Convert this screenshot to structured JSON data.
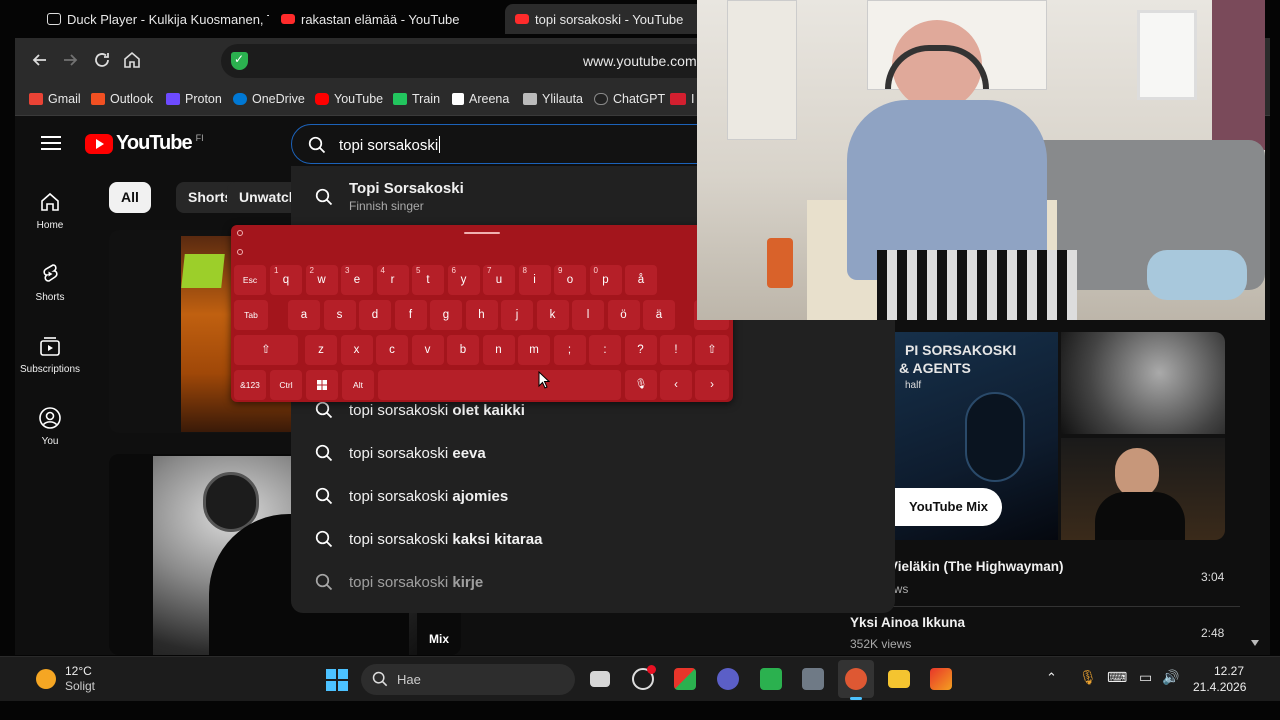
{
  "browser": {
    "tabs": [
      {
        "title": "Duck Player - Kulkija Kuosmanen, T"
      },
      {
        "title": "rakastan elämää - YouTube"
      },
      {
        "title": "topi sorsakoski - YouTube"
      }
    ],
    "url": "www.youtube.com",
    "bookmarks": [
      {
        "label": "Gmail",
        "color": "#ea4335"
      },
      {
        "label": "Outlook",
        "color": "#f25022"
      },
      {
        "label": "Proton",
        "color": "#6d4aff"
      },
      {
        "label": "OneDrive",
        "color": "#0078d4"
      },
      {
        "label": "YouTube",
        "color": "#ff0000"
      },
      {
        "label": "Train",
        "color": "#22c55e"
      },
      {
        "label": "Areena",
        "color": "#ffffff"
      },
      {
        "label": "Ylilauta",
        "color": "#bbbbbb"
      },
      {
        "label": "ChatGPT",
        "color": "#222222"
      },
      {
        "label": "I",
        "color": "#d31f2f"
      }
    ]
  },
  "youtube": {
    "logo_text": "YouTube",
    "country_code": "FI",
    "search": {
      "query": "topi sorsakoski"
    },
    "sidebar": [
      {
        "label": "Home",
        "icon": "home-icon"
      },
      {
        "label": "Shorts",
        "icon": "shorts-icon"
      },
      {
        "label": "Subscriptions",
        "icon": "subscriptions-icon"
      },
      {
        "label": "You",
        "icon": "account-icon"
      }
    ],
    "chips": [
      "All",
      "Shorts",
      "Unwatch"
    ],
    "suggestions": {
      "top": {
        "title": "Topi Sorsakoski",
        "subtitle": "Finnish singer"
      },
      "items": [
        {
          "prefix": "topi sorsakoski ",
          "rest": "olet kaikki"
        },
        {
          "prefix": "topi sorsakoski ",
          "rest": "eeva"
        },
        {
          "prefix": "topi sorsakoski ",
          "rest": "ajomies"
        },
        {
          "prefix": "topi sorsakoski ",
          "rest": "kaksi kitaraa"
        },
        {
          "prefix": "topi sorsakoski ",
          "rest": "kirje"
        }
      ]
    },
    "mix": {
      "album_title_line1": "PI SORSAKOSKI",
      "album_title_line2": "& AGENTS",
      "album_sub": "half",
      "badge": "YouTube Mix"
    },
    "thumb_badge": "Mix",
    "right_videos": [
      {
        "title": "n Vieläkin (The Highwayman)",
        "views": "ews",
        "duration": "3:04"
      },
      {
        "title": "Yksi Ainoa Ikkuna",
        "views": "352K views",
        "duration": "2:48"
      }
    ]
  },
  "keyboard": {
    "row1": [
      {
        "main": "q",
        "alt": "1"
      },
      {
        "main": "w",
        "alt": "2"
      },
      {
        "main": "e",
        "alt": "3"
      },
      {
        "main": "r",
        "alt": "4"
      },
      {
        "main": "t",
        "alt": "5"
      },
      {
        "main": "y",
        "alt": "6"
      },
      {
        "main": "u",
        "alt": "7"
      },
      {
        "main": "i",
        "alt": "8"
      },
      {
        "main": "o",
        "alt": "9"
      },
      {
        "main": "p",
        "alt": "0"
      },
      {
        "main": "å",
        "alt": ""
      }
    ],
    "row2": [
      "a",
      "s",
      "d",
      "f",
      "g",
      "h",
      "j",
      "k",
      "l",
      "ö",
      "ä"
    ],
    "row3": [
      "z",
      "x",
      "c",
      "v",
      "b",
      "n",
      "m",
      ";",
      ":",
      "?",
      "!"
    ],
    "esc": "Esc",
    "tab": "Tab",
    "sym": "&123",
    "ctrl": "Ctrl",
    "alt": "Alt"
  },
  "taskbar": {
    "weather": {
      "temp": "12°C",
      "condition": "Soligt"
    },
    "search_placeholder": "Hae",
    "time": "12.27",
    "date": "21.4.2026"
  }
}
